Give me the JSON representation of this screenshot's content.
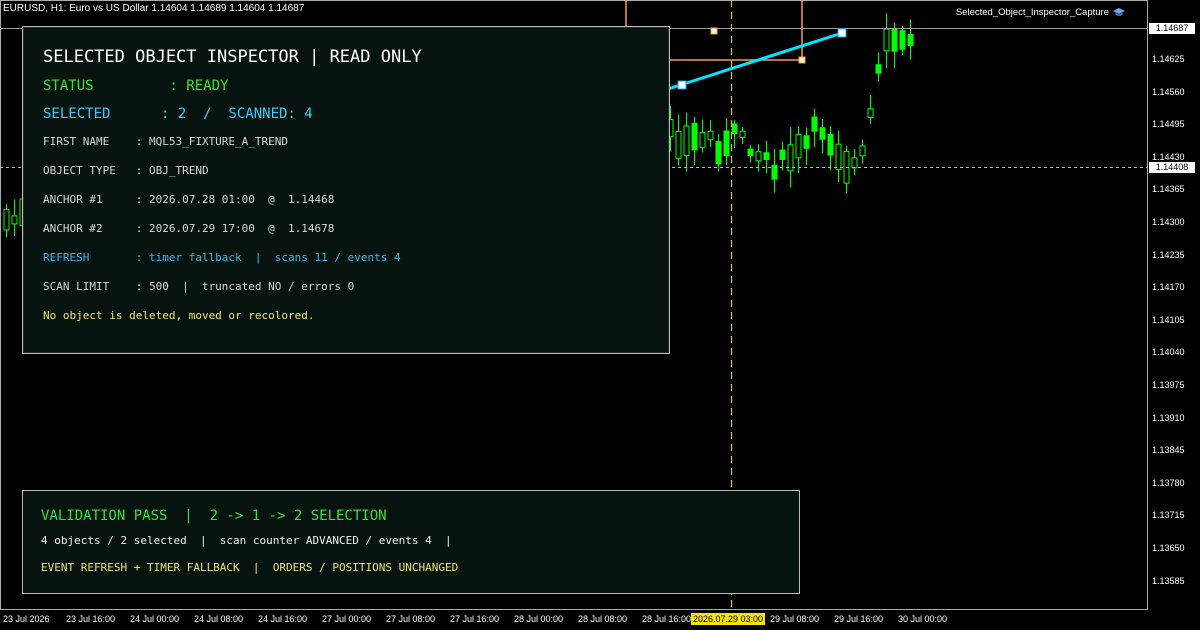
{
  "chart_header": {
    "symbol_line": "EURUSD, H1:  Euro vs US Dollar  1.14604 1.14689 1.14604 1.14687",
    "capture_label": "Selected_Object_Inspector_Capture",
    "capture_icon": "graduation-cap-icon"
  },
  "price_axis": {
    "labels": [
      "1.14625",
      "1.14560",
      "1.14495",
      "1.14430",
      "1.14365",
      "1.14300",
      "1.14235",
      "1.14170",
      "1.14105",
      "1.14040",
      "1.13975",
      "1.13910",
      "1.13845",
      "1.13780",
      "1.13715",
      "1.13650",
      "1.13585"
    ],
    "current_price_tag": "1.14687",
    "crosshair_price_tag": "1.14408"
  },
  "time_axis": {
    "labels": [
      "23 Jul 2026",
      "23 Jul 16:00",
      "24 Jul 00:00",
      "24 Jul 08:00",
      "24 Jul 16:00",
      "27 Jul 00:00",
      "27 Jul 08:00",
      "27 Jul 16:00",
      "28 Jul 00:00",
      "28 Jul 08:00",
      "28 Jul 16:00",
      "29 Jul 08:00",
      "29 Jul 16:00",
      "30 Jul 00:00"
    ],
    "highlight_label": "2026.07.29 03:00"
  },
  "inspector": {
    "title": "SELECTED OBJECT INSPECTOR  |  READ ONLY",
    "status": "STATUS         : READY",
    "selected": "SELECTED      : 2  /  SCANNED: 4",
    "first_name": "FIRST NAME    : MQL53_FIXTURE_A_TREND",
    "object_type": "OBJECT TYPE   : OBJ_TREND",
    "anchor1": "ANCHOR #1     : 2026.07.28 01:00  @  1.14468",
    "anchor2": "ANCHOR #2     : 2026.07.29 17:00  @  1.14678",
    "refresh": "REFRESH       : timer fallback  |  scans 11 / events 4",
    "scan_limit": "SCAN LIMIT    : 500  |  truncated NO / errors 0",
    "note": "No object is deleted, moved or recolored."
  },
  "validation": {
    "title": "VALIDATION PASS  |  2 -> 1 -> 2 SELECTION",
    "line1": "4 objects / 2 selected  |  scan counter ADVANCED / events 4  |",
    "line2": "EVENT REFRESH + TIMER FALLBACK  |  ORDERS / POSITIONS UNCHANGED"
  },
  "colors": {
    "candle_bull": "#00ff00",
    "trendline": "#00e5ff",
    "rectangle": "#f0a050",
    "vertical_line": "#f0c000",
    "status_green": "#35e23a",
    "info_cyan": "#33d0ff",
    "note_yellow": "#f2e56a"
  }
}
